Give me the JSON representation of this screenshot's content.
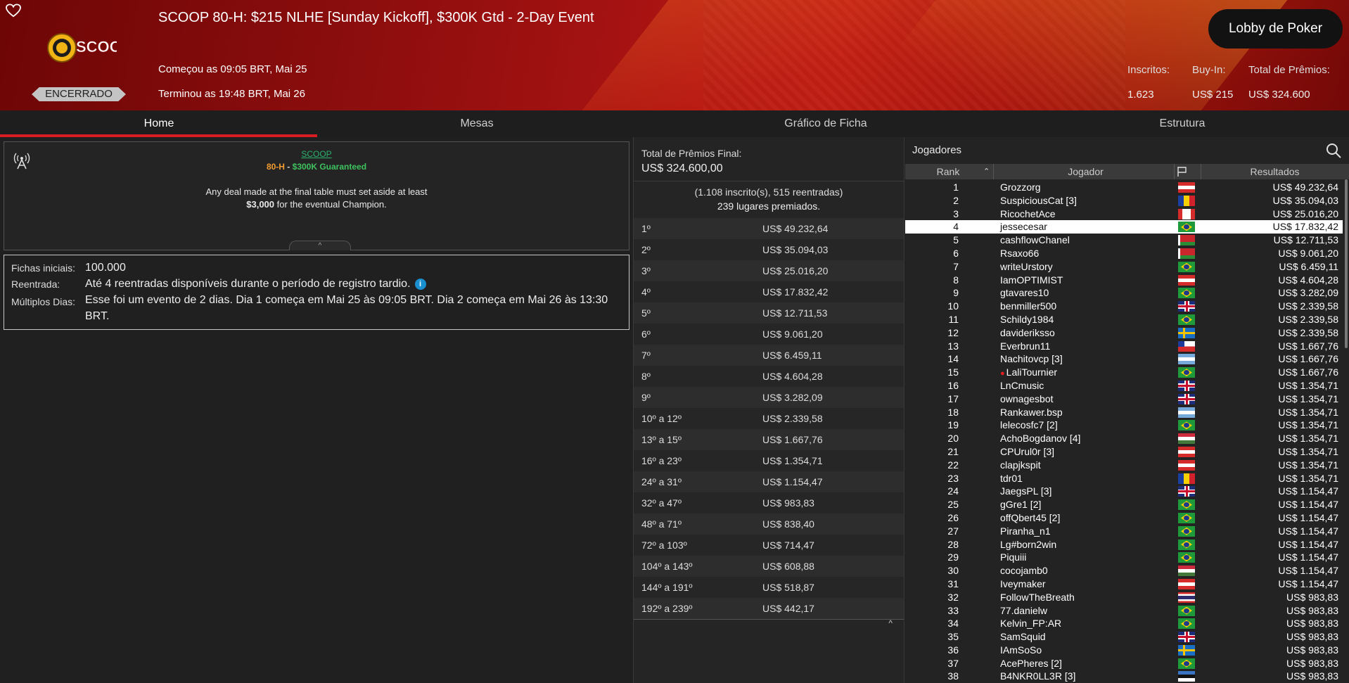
{
  "header": {
    "title": "SCOOP 80-H: $215 NLHE [Sunday Kickoff], $300K Gtd - 2-Day Event",
    "started": "Começou as 09:05 BRT, Mai 25",
    "ended": "Terminou as 19:48 BRT, Mai 26",
    "status": "ENCERRADO",
    "logo_text": "SCOOP",
    "lobby_button": "Lobby de Poker",
    "stats": {
      "entries_label": "Inscritos:",
      "entries_value": "1.623",
      "buyin_label": "Buy-In:",
      "buyin_value": "US$ 215",
      "prize_label": "Total de Prêmios:",
      "prize_value": "US$ 324.600"
    },
    "colors": {
      "brand_red": "#c01a14",
      "accent_orange": "#f39c32"
    }
  },
  "tabs": [
    {
      "label": "Home",
      "active": true
    },
    {
      "label": "Mesas",
      "active": false
    },
    {
      "label": "Gráfico de Ficha",
      "active": false
    },
    {
      "label": "Estrutura",
      "active": false
    }
  ],
  "info": {
    "series": "SCOOP",
    "event_code": "80-H",
    "separator": " - ",
    "guarantee": "$300K Guaranteed",
    "deal_text_1": "Any deal made at the final table must set aside at least",
    "deal_amount": "$3,000",
    "deal_text_2": " for the eventual Champion."
  },
  "details": {
    "starting_chips_label": "Fichas iniciais:",
    "starting_chips_value": "100.000",
    "reentry_label": "Reentrada:",
    "reentry_value": "Até 4 reentradas disponíveis durante o período de registro tardio.",
    "multiday_label": "Múltiplos Dias:",
    "multiday_value": "Esse foi um evento de 2 dias. Dia 1 começa em Mai 25 às 09:05 BRT. Dia 2 começa em Mai 26 às 13:30 BRT."
  },
  "prizes": {
    "total_label": "Total de Prêmios Final:",
    "total_value": "US$ 324.600,00",
    "entries_line": "(1.108 inscrito(s), 515 reentradas)",
    "paid_line": "239 lugares premiados.",
    "rows": [
      {
        "pos": "1º",
        "amount": "US$ 49.232,64"
      },
      {
        "pos": "2º",
        "amount": "US$ 35.094,03"
      },
      {
        "pos": "3º",
        "amount": "US$ 25.016,20"
      },
      {
        "pos": "4º",
        "amount": "US$ 17.832,42"
      },
      {
        "pos": "5º",
        "amount": "US$ 12.711,53"
      },
      {
        "pos": "6º",
        "amount": "US$ 9.061,20"
      },
      {
        "pos": "7º",
        "amount": "US$ 6.459,11"
      },
      {
        "pos": "8º",
        "amount": "US$ 4.604,28"
      },
      {
        "pos": "9º",
        "amount": "US$ 3.282,09"
      },
      {
        "pos": "10º a 12º",
        "amount": "US$ 2.339,58"
      },
      {
        "pos": "13º a 15º",
        "amount": "US$ 1.667,76"
      },
      {
        "pos": "16º a 23º",
        "amount": "US$ 1.354,71"
      },
      {
        "pos": "24º a 31º",
        "amount": "US$ 1.154,47"
      },
      {
        "pos": "32º a 47º",
        "amount": "US$ 983,83"
      },
      {
        "pos": "48º a 71º",
        "amount": "US$ 838,40"
      },
      {
        "pos": "72º a 103º",
        "amount": "US$ 714,47"
      },
      {
        "pos": "104º a 143º",
        "amount": "US$ 608,88"
      },
      {
        "pos": "144º a 191º",
        "amount": "US$ 518,87"
      },
      {
        "pos": "192º a 239º",
        "amount": "US$ 442,17"
      }
    ]
  },
  "players": {
    "title": "Jogadores",
    "columns": {
      "rank": "Rank",
      "player": "Jogador",
      "results": "Resultados"
    },
    "rows": [
      {
        "rank": "1",
        "name": "Grozzorg",
        "flag": "at",
        "result": "US$ 49.232,64"
      },
      {
        "rank": "2",
        "name": "SuspiciousCat [3]",
        "flag": "ad",
        "result": "US$ 35.094,03"
      },
      {
        "rank": "3",
        "name": "RicochetAce",
        "flag": "ca",
        "result": "US$ 25.016,20"
      },
      {
        "rank": "4",
        "name": "jessecesar",
        "flag": "br",
        "result": "US$ 17.832,42",
        "highlight": true
      },
      {
        "rank": "5",
        "name": "cashflowChanel",
        "flag": "by",
        "result": "US$ 12.711,53"
      },
      {
        "rank": "6",
        "name": "Rsaxo66",
        "flag": "by",
        "result": "US$ 9.061,20"
      },
      {
        "rank": "7",
        "name": "writeUrstory",
        "flag": "br",
        "result": "US$ 6.459,11"
      },
      {
        "rank": "8",
        "name": "IamOPTIMIST",
        "flag": "at",
        "result": "US$ 4.604,28"
      },
      {
        "rank": "9",
        "name": "gtavares10",
        "flag": "br",
        "result": "US$ 3.282,09"
      },
      {
        "rank": "10",
        "name": "benmiller500",
        "flag": "gb",
        "result": "US$ 2.339,58"
      },
      {
        "rank": "11",
        "name": "Schildy1984",
        "flag": "br",
        "result": "US$ 2.339,58"
      },
      {
        "rank": "12",
        "name": "daviderikssо",
        "flag": "se",
        "result": "US$ 2.339,58"
      },
      {
        "rank": "13",
        "name": "Everbrun11",
        "flag": "cl",
        "result": "US$ 1.667,76"
      },
      {
        "rank": "14",
        "name": "Nachitovcp [3]",
        "flag": "ar",
        "result": "US$ 1.667,76"
      },
      {
        "rank": "15",
        "name": "LaliTournier",
        "flag": "br",
        "result": "US$ 1.667,76",
        "star": true
      },
      {
        "rank": "16",
        "name": "LnCmusic",
        "flag": "gb",
        "result": "US$ 1.354,71"
      },
      {
        "rank": "17",
        "name": "ownagesbot",
        "flag": "gb",
        "result": "US$ 1.354,71"
      },
      {
        "rank": "18",
        "name": "Rankawer.bsp",
        "flag": "ar",
        "result": "US$ 1.354,71"
      },
      {
        "rank": "19",
        "name": "lelecosfc7 [2]",
        "flag": "br",
        "result": "US$ 1.354,71"
      },
      {
        "rank": "20",
        "name": "AchoBogdanov [4]",
        "flag": "hu",
        "result": "US$ 1.354,71"
      },
      {
        "rank": "21",
        "name": "CPUrul0r [3]",
        "flag": "at",
        "result": "US$ 1.354,71"
      },
      {
        "rank": "22",
        "name": "clapjkspit",
        "flag": "at",
        "result": "US$ 1.354,71"
      },
      {
        "rank": "23",
        "name": "tdr01",
        "flag": "ro",
        "result": "US$ 1.354,71"
      },
      {
        "rank": "24",
        "name": "JaegsPL [3]",
        "flag": "gb",
        "result": "US$ 1.154,47"
      },
      {
        "rank": "25",
        "name": "gGre1 [2]",
        "flag": "br",
        "result": "US$ 1.154,47"
      },
      {
        "rank": "26",
        "name": "offQbert45 [2]",
        "flag": "br",
        "result": "US$ 1.154,47"
      },
      {
        "rank": "27",
        "name": "Piranha_n1",
        "flag": "br",
        "result": "US$ 1.154,47"
      },
      {
        "rank": "28",
        "name": "Lg#born2win",
        "flag": "br",
        "result": "US$ 1.154,47"
      },
      {
        "rank": "29",
        "name": "Piquiii",
        "flag": "br",
        "result": "US$ 1.154,47"
      },
      {
        "rank": "30",
        "name": "cocojamb0",
        "flag": "hu",
        "result": "US$ 1.154,47"
      },
      {
        "rank": "31",
        "name": "Iveymaker",
        "flag": "at",
        "result": "US$ 1.154,47"
      },
      {
        "rank": "32",
        "name": "FollowTheBreath",
        "flag": "th",
        "result": "US$ 983,83"
      },
      {
        "rank": "33",
        "name": "77.danielw",
        "flag": "br",
        "result": "US$ 983,83"
      },
      {
        "rank": "34",
        "name": "Kelvin_FP:AR",
        "flag": "br",
        "result": "US$ 983,83"
      },
      {
        "rank": "35",
        "name": "SamSquid",
        "flag": "gb",
        "result": "US$ 983,83"
      },
      {
        "rank": "36",
        "name": "IAmSoSo",
        "flag": "se",
        "result": "US$ 983,83"
      },
      {
        "rank": "37",
        "name": "AcePheres [2]",
        "flag": "br",
        "result": "US$ 983,83"
      },
      {
        "rank": "38",
        "name": "B4NKR0LL3R [3]",
        "flag": "ee",
        "result": "US$ 983,83"
      }
    ]
  }
}
